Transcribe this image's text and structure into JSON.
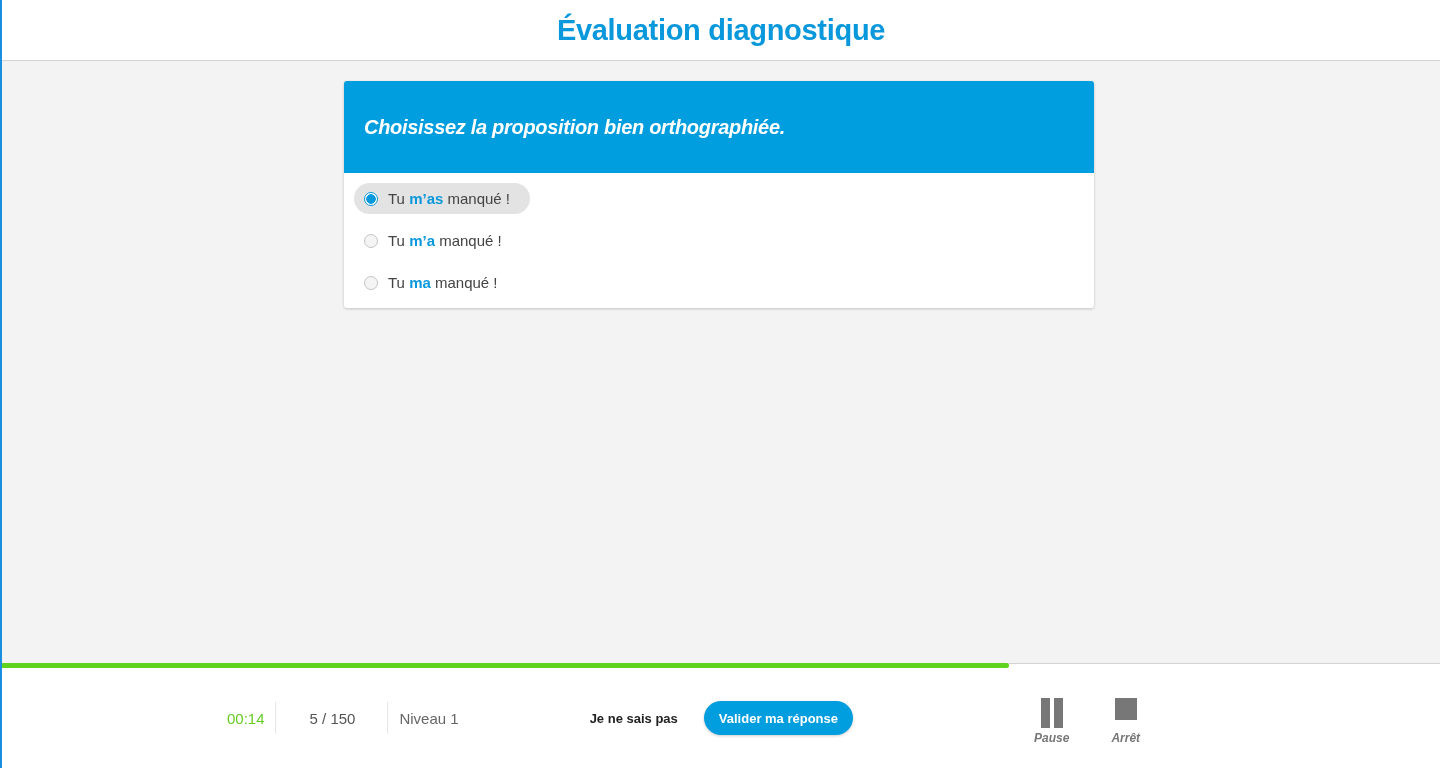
{
  "header": {
    "title": "Évaluation diagnostique"
  },
  "question": {
    "prompt": "Choisissez la proposition bien orthographiée.",
    "options": [
      {
        "label": "Tu **m’as** manqué !",
        "selected": true
      },
      {
        "label": "Tu **m’a** manqué !",
        "selected": false
      },
      {
        "label": "Tu **ma** manqué !",
        "selected": false
      }
    ]
  },
  "progress": {
    "level": 0.7
  },
  "footer": {
    "timer": "00:14",
    "count": "5 / 150",
    "level_label": "Niveau 1",
    "skip_button": "Je ne sais pas",
    "submit_button": "Valider ma réponse",
    "controls": [
      {
        "kind": "pause",
        "label": "Pause"
      },
      {
        "kind": "stop",
        "label": "Arrêt"
      }
    ]
  }
}
